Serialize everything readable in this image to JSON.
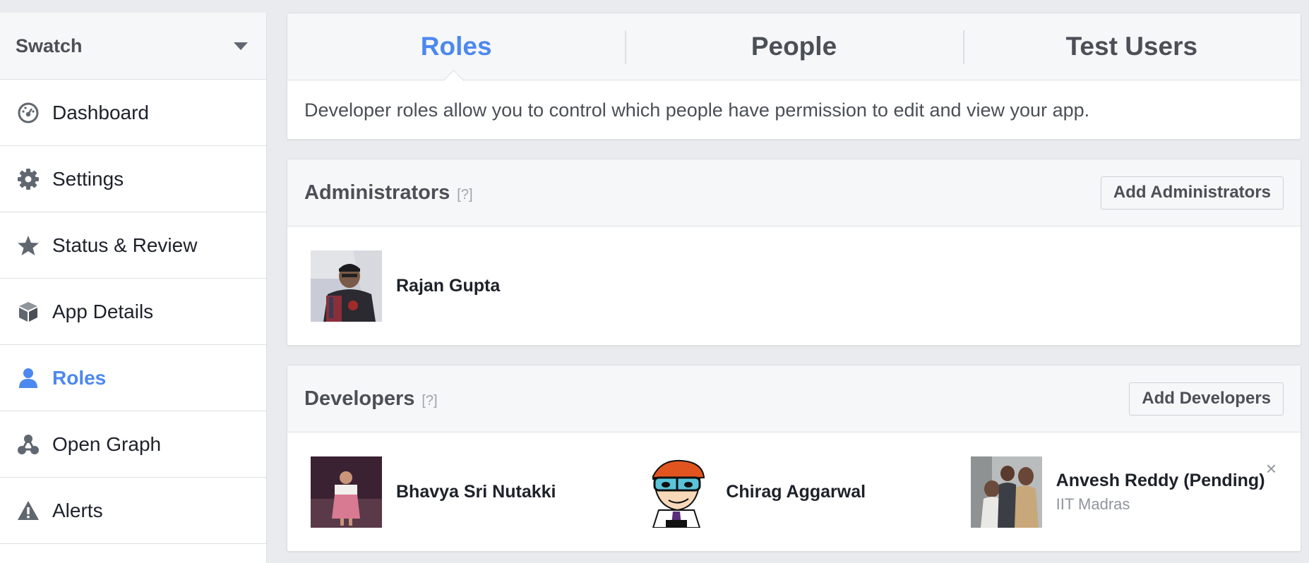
{
  "sidebar": {
    "app_name": "Swatch",
    "items": [
      {
        "label": "Dashboard",
        "icon": "dashboard-icon"
      },
      {
        "label": "Settings",
        "icon": "gear-icon"
      },
      {
        "label": "Status & Review",
        "icon": "star-icon"
      },
      {
        "label": "App Details",
        "icon": "cube-icon"
      },
      {
        "label": "Roles",
        "icon": "person-icon",
        "active": true
      },
      {
        "label": "Open Graph",
        "icon": "graph-icon"
      },
      {
        "label": "Alerts",
        "icon": "warning-icon"
      }
    ]
  },
  "tabs": {
    "items": [
      {
        "label": "Roles",
        "active": true
      },
      {
        "label": "People"
      },
      {
        "label": "Test Users"
      }
    ],
    "description": "Developer roles allow you to control which people have permission to edit and view your app."
  },
  "administrators": {
    "title": "Administrators",
    "help": "[?]",
    "button": "Add Administrators",
    "people": [
      {
        "name": "Rajan Gupta"
      }
    ]
  },
  "developers": {
    "title": "Developers",
    "help": "[?]",
    "button": "Add Developers",
    "people": [
      {
        "name": "Bhavya Sri Nutakki"
      },
      {
        "name": "Chirag Aggarwal"
      },
      {
        "name": "Anvesh Reddy (Pending)",
        "subtitle": "IIT Madras"
      }
    ],
    "remove_glyph": "×"
  },
  "colors": {
    "accent": "#4c88ef",
    "text_dark": "#4b4f56",
    "background": "#e9ebee"
  }
}
